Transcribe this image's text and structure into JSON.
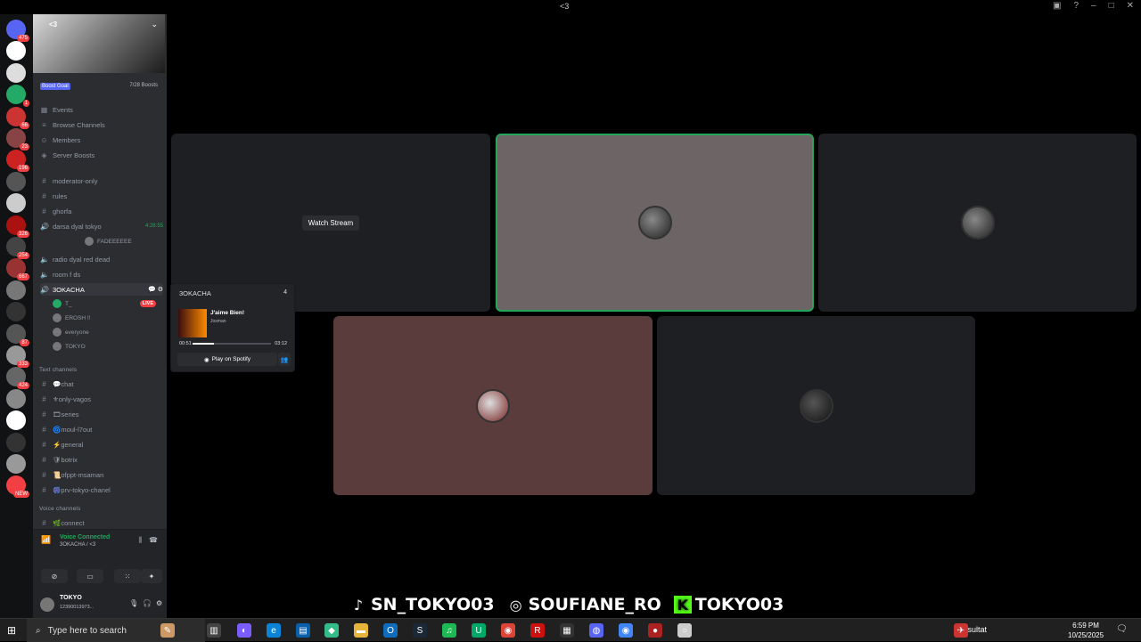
{
  "window": {
    "title": "<3"
  },
  "server": {
    "name": "<3",
    "boost_goal_label": "Boost Goal",
    "boost_count": "7/28 Boosts"
  },
  "rail_badges": [
    "475",
    "",
    "",
    "1",
    "66",
    "23",
    "196",
    "",
    "",
    "326",
    "254",
    "667",
    "",
    "",
    "87",
    "333",
    "424",
    "",
    "",
    "",
    "",
    "NEW"
  ],
  "nav": [
    {
      "label": "Events",
      "icon": "calendar-icon"
    },
    {
      "label": "Browse Channels",
      "icon": "browse-icon"
    },
    {
      "label": "Members",
      "icon": "members-icon"
    },
    {
      "label": "Server Boosts",
      "icon": "boost-icon"
    }
  ],
  "channels_top": [
    {
      "label": "moderator-only",
      "type": "text"
    },
    {
      "label": "rules",
      "type": "text"
    },
    {
      "label": "ghorfa",
      "type": "text"
    },
    {
      "label": "darsa dyal tokyo",
      "type": "voice",
      "timer": "4:28:55"
    },
    {
      "label": "radio dyal red dead",
      "type": "voice"
    },
    {
      "label": "room f ds",
      "type": "voice"
    },
    {
      "label": "3OKACHA",
      "type": "voice"
    }
  ],
  "darsa_member": "FADEEEEEE",
  "okacha_members": [
    {
      "name": "T_",
      "live": "LIVE"
    },
    {
      "name": "EROSH !!"
    },
    {
      "name": "everyone"
    },
    {
      "name": "TOKYO"
    }
  ],
  "text_category": "Text channels",
  "text_channels": [
    "💬chat",
    "⚜only-vagos",
    "🎞series",
    "🌀moul-l7out",
    "⚡general",
    "🛡botrix",
    "📜ofppt-msaman",
    "🎆prv-tokyo-chanel"
  ],
  "voice_category": "Voice channels",
  "voice_channels": [
    "🌿connect"
  ],
  "voice_panel": {
    "status": "Voice Connected",
    "sub": "3OKACHA / <3"
  },
  "user": {
    "name": "TOKYO",
    "tag": "12390013973..."
  },
  "stage": {
    "watch_stream": "Watch Stream"
  },
  "popup": {
    "channel": "3OKACHA",
    "count": "4",
    "song": "J'aime Bien!",
    "artist": "Josman",
    "time_start": "00:51",
    "time_end": "03:12",
    "progress": 0.27,
    "spotify_label": "Play on Spotify"
  },
  "socials": [
    {
      "icon": "tiktok-icon",
      "glyph": "♪",
      "label": "SN_TOKYO03"
    },
    {
      "icon": "instagram-icon",
      "glyph": "◎",
      "label": "SOUFIANE_RO"
    },
    {
      "icon": "kick-icon",
      "glyph": "K",
      "label": "TOKYO03"
    }
  ],
  "taskbar": {
    "search_placeholder": "Type here to search",
    "resultat": "Résultat",
    "time": "6:59 PM",
    "date": "10/25/2025"
  },
  "colors": {
    "accent": "#5865f2",
    "voice_green": "#23a55a",
    "live_red": "#f23f43"
  }
}
